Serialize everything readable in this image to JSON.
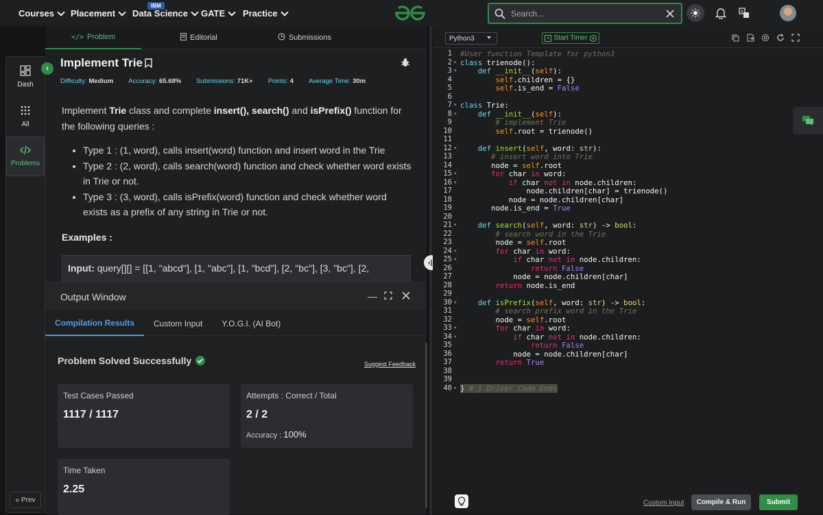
{
  "nav": {
    "items": [
      {
        "label": "Courses"
      },
      {
        "label": "Placement"
      },
      {
        "label": "Data Science",
        "badge": "IBM"
      },
      {
        "label": "GATE"
      },
      {
        "label": "Practice"
      }
    ],
    "search_placeholder": "Search...",
    "brand_color": "#2f8d46"
  },
  "sidebar": {
    "items": [
      {
        "label": "Dash",
        "icon": "dashboard-icon"
      },
      {
        "label": "All",
        "icon": "grid-icon"
      },
      {
        "label": "Problems",
        "icon": "code-icon"
      }
    ],
    "prev_label": "Prev"
  },
  "problem": {
    "tabs": [
      {
        "label": "Problem",
        "icon": "</>"
      },
      {
        "label": "Editorial"
      },
      {
        "label": "Submissions"
      }
    ],
    "title": "Implement Trie",
    "meta": {
      "difficulty_label": "Difficulty:",
      "difficulty": "Medium",
      "accuracy_label": "Accuracy:",
      "accuracy": "65.68%",
      "submissions_label": "Submissions:",
      "submissions": "71K+",
      "points_label": "Points:",
      "points": "4",
      "avg_time_label": "Average Time:",
      "avg_time": "30m"
    },
    "desc": {
      "p1": "Implement ",
      "b1": "Trie",
      "p2": " class and complete ",
      "b2": "insert(), search()",
      "p3": " and ",
      "b3": "isPrefix()",
      "p4": " function for the following queries :"
    },
    "bullets": [
      "Type 1 : (1, word), calls insert(word) function and insert word in the Trie",
      "Type 2 : (2, word), calls search(word) function and check whether word exists in Trie or not.",
      "Type 3 : (3, word), calls isPrefix(word) function and check whether word exists as a prefix of any string in Trie or not."
    ],
    "examples_heading": "Examples :",
    "example_input_label": "Input:",
    "example_input": "query[][] = [[1, \"abcd\"], [1, \"abc\"], [1, \"bcd\"], [2, \"bc\"], [3, \"bc\"], [2,"
  },
  "output": {
    "title": "Output Window",
    "tabs": [
      {
        "label": "Compilation Results"
      },
      {
        "label": "Custom Input"
      },
      {
        "label": "Y.O.G.I. (AI Bot)"
      }
    ],
    "status": "Problem Solved Successfully",
    "feedback_label": "Suggest Feedback",
    "test_cases_label": "Test Cases Passed",
    "test_cases_value": "1117 / 1117",
    "attempts_label": "Attempts : Correct / Total",
    "attempts_value": "2 / 2",
    "accuracy_label": "Accuracy :",
    "accuracy_value": "100%",
    "time_label": "Time Taken",
    "time_value": "2.25"
  },
  "editor": {
    "language": "Python3",
    "timer_label": "Start Timer",
    "custom_input_label": "Custom Input",
    "compile_label": "Compile & Run",
    "submit_label": "Submit",
    "line_numbers": [
      "1",
      "2",
      "3",
      "4",
      "5",
      "6",
      "7",
      "8",
      "9",
      "10",
      "11",
      "12",
      "13",
      "14",
      "15",
      "16",
      "17",
      "18",
      "19",
      "20",
      "21",
      "22",
      "23",
      "24",
      "25",
      "26",
      "27",
      "28",
      "29",
      "30",
      "31",
      "32",
      "33",
      "34",
      "35",
      "36",
      "37",
      "38",
      "39",
      "40"
    ],
    "code": {
      "l1": "#User function Template for python3",
      "l2a": "class",
      "l2b": " trienode():",
      "l3a": "    def ",
      "l3b": "__init__",
      "l3c": "(",
      "l3d": "self",
      "l3e": "):",
      "l4a": "        ",
      "l4b": "self",
      "l4c": ".children = {}",
      "l5a": "        ",
      "l5b": "self",
      "l5c": ".is_end = ",
      "l5d": "False",
      "l7a": "class",
      "l7b": " Trie:",
      "l8a": "    def ",
      "l8b": "__init__",
      "l8c": "(",
      "l8d": "self",
      "l8e": "):",
      "l9": "        # implement Trie",
      "l10a": "        ",
      "l10b": "self",
      "l10c": ".root = trienode()",
      "l12a": "    def ",
      "l12b": "insert",
      "l12c": "(",
      "l12d": "self",
      "l12e": ", word: ",
      "l12f": "str",
      "l12g": "):",
      "l13": "       # insert word into Trie",
      "l14a": "       node = ",
      "l14b": "self",
      "l14c": ".root",
      "l15a": "       ",
      "l15b": "for",
      "l15c": " char ",
      "l15d": "in",
      "l15e": " word:",
      "l16a": "           ",
      "l16b": "if",
      "l16c": " char ",
      "l16d": "not in",
      "l16e": " node.children:",
      "l17": "               node.children[char] = trienode()",
      "l18": "           node = node.children[char]",
      "l19a": "       node.is_end = ",
      "l19b": "True",
      "l21a": "    def ",
      "l21b": "search",
      "l21c": "(",
      "l21d": "self",
      "l21e": ", word: ",
      "l21f": "str",
      "l21g": ") -> ",
      "l21h": "bool",
      "l21i": ":",
      "l22": "        # search word in the Trie",
      "l23a": "        node = ",
      "l23b": "self",
      "l23c": ".root",
      "l24a": "        ",
      "l24b": "for",
      "l24c": " char ",
      "l24d": "in",
      "l24e": " word:",
      "l25a": "            ",
      "l25b": "if",
      "l25c": " char ",
      "l25d": "not in",
      "l25e": " node.children:",
      "l26a": "                ",
      "l26b": "return",
      "l26c": " False",
      "l27": "            node = node.children[char]",
      "l28a": "        ",
      "l28b": "return",
      "l28c": " node.is_end",
      "l30a": "    def ",
      "l30b": "isPrefix",
      "l30c": "(",
      "l30d": "self",
      "l30e": ", word: ",
      "l30f": "str",
      "l30g": ") -> ",
      "l30h": "bool",
      "l30i": ":",
      "l31": "        # search prefix word in the Trie",
      "l32a": "        node = ",
      "l32b": "self",
      "l32c": ".root",
      "l33a": "        ",
      "l33b": "for",
      "l33c": " char ",
      "l33d": "in",
      "l33e": " word:",
      "l34a": "            ",
      "l34b": "if",
      "l34c": " char ",
      "l34d": "not in",
      "l34e": " node.children:",
      "l35a": "                ",
      "l35b": "return",
      "l35c": " False",
      "l36": "            node = node.children[char]",
      "l37a": "        ",
      "l37b": "return",
      "l37c": " True",
      "l40a": "} ",
      "l40b": "# } Driver Code Ends"
    }
  }
}
